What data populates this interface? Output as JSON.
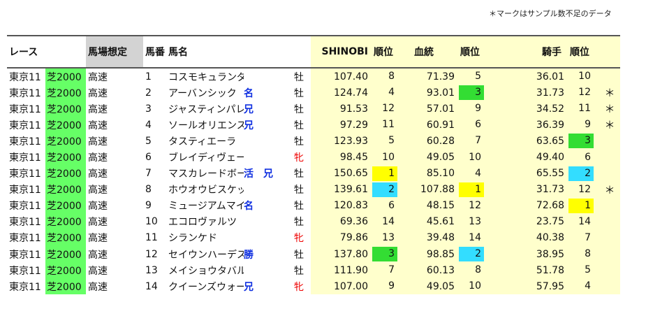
{
  "note": "＊マークはサンプル数不足のデータ",
  "headers": {
    "race": "レース",
    "condition": "馬場想定",
    "number": "馬番",
    "name": "馬名",
    "shinobi": "SHINOBI",
    "shinobi_rank": "順位",
    "blood": "血統",
    "blood_rank": "順位",
    "jockey": "騎手",
    "jockey_rank": "順位"
  },
  "colors": {
    "surface_green": "#66ff66",
    "highlight_yellow": "#ffff00",
    "highlight_green": "#33dd33",
    "highlight_cyan": "#33ddff",
    "pale_yellow": "#ffffcc",
    "mark_blue": "#1030e0",
    "female_red": "#ee0000"
  },
  "rows": [
    {
      "race": "東京11",
      "surface": "芝2000",
      "cond": "高速",
      "num": "1",
      "name": "コスモキュランダ",
      "mark": "",
      "sex": "牡",
      "shinobi": "107.40",
      "sr": "8",
      "srh": "",
      "blood": "71.39",
      "br": "5",
      "brh": "",
      "jockey": "36.01",
      "jr": "10",
      "jrh": "",
      "star": ""
    },
    {
      "race": "東京11",
      "surface": "芝2000",
      "cond": "高速",
      "num": "2",
      "name": "アーバンシック",
      "mark": "名",
      "sex": "牡",
      "shinobi": "124.74",
      "sr": "4",
      "srh": "",
      "blood": "93.01",
      "br": "3",
      "brh": "green",
      "jockey": "31.73",
      "jr": "12",
      "jrh": "",
      "star": "＊"
    },
    {
      "race": "東京11",
      "surface": "芝2000",
      "cond": "高速",
      "num": "3",
      "name": "ジャスティンパレス",
      "mark": "兄",
      "sex": "牡",
      "shinobi": "91.53",
      "sr": "12",
      "srh": "",
      "blood": "57.01",
      "br": "9",
      "brh": "",
      "jockey": "34.52",
      "jr": "11",
      "jrh": "",
      "star": "＊"
    },
    {
      "race": "東京11",
      "surface": "芝2000",
      "cond": "高速",
      "num": "4",
      "name": "ソールオリエンス",
      "mark": "兄",
      "sex": "牡",
      "shinobi": "97.29",
      "sr": "11",
      "srh": "",
      "blood": "60.91",
      "br": "6",
      "brh": "",
      "jockey": "36.39",
      "jr": "9",
      "jrh": "",
      "star": "＊"
    },
    {
      "race": "東京11",
      "surface": "芝2000",
      "cond": "高速",
      "num": "5",
      "name": "タスティエーラ",
      "mark": "",
      "sex": "牡",
      "shinobi": "123.93",
      "sr": "5",
      "srh": "",
      "blood": "60.28",
      "br": "7",
      "brh": "",
      "jockey": "63.65",
      "jr": "3",
      "jrh": "green",
      "star": ""
    },
    {
      "race": "東京11",
      "surface": "芝2000",
      "cond": "高速",
      "num": "6",
      "name": "ブレイディヴェーグ",
      "mark": "",
      "sex": "牝",
      "shinobi": "98.45",
      "sr": "10",
      "srh": "",
      "blood": "49.05",
      "br": "10",
      "brh": "",
      "jockey": "49.40",
      "jr": "6",
      "jrh": "",
      "star": ""
    },
    {
      "race": "東京11",
      "surface": "芝2000",
      "cond": "高速",
      "num": "7",
      "name": "マスカレードボール",
      "mark": "活　兄",
      "sex": "牡",
      "shinobi": "150.65",
      "sr": "1",
      "srh": "yellow",
      "blood": "85.10",
      "br": "4",
      "brh": "",
      "jockey": "65.55",
      "jr": "2",
      "jrh": "cyan",
      "star": ""
    },
    {
      "race": "東京11",
      "surface": "芝2000",
      "cond": "高速",
      "num": "8",
      "name": "ホウオウビスケッツ",
      "mark": "",
      "sex": "牡",
      "shinobi": "139.61",
      "sr": "2",
      "srh": "cyan",
      "blood": "107.88",
      "br": "1",
      "brh": "yellow",
      "jockey": "31.73",
      "jr": "12",
      "jrh": "",
      "star": "＊"
    },
    {
      "race": "東京11",
      "surface": "芝2000",
      "cond": "高速",
      "num": "9",
      "name": "ミュージアムマイル",
      "mark": "名",
      "sex": "牡",
      "shinobi": "120.83",
      "sr": "6",
      "srh": "",
      "blood": "48.15",
      "br": "12",
      "brh": "",
      "jockey": "72.68",
      "jr": "1",
      "jrh": "yellow",
      "star": ""
    },
    {
      "race": "東京11",
      "surface": "芝2000",
      "cond": "高速",
      "num": "10",
      "name": "エコロヴァルツ",
      "mark": "",
      "sex": "牡",
      "shinobi": "69.36",
      "sr": "14",
      "srh": "",
      "blood": "45.61",
      "br": "13",
      "brh": "",
      "jockey": "23.75",
      "jr": "14",
      "jrh": "",
      "star": ""
    },
    {
      "race": "東京11",
      "surface": "芝2000",
      "cond": "高速",
      "num": "11",
      "name": "シランケド",
      "mark": "",
      "sex": "牝",
      "shinobi": "79.86",
      "sr": "13",
      "srh": "",
      "blood": "39.48",
      "br": "14",
      "brh": "",
      "jockey": "40.38",
      "jr": "7",
      "jrh": "",
      "star": ""
    },
    {
      "race": "東京11",
      "surface": "芝2000",
      "cond": "高速",
      "num": "12",
      "name": "セイウンハーデス",
      "mark": "勝",
      "sex": "牡",
      "shinobi": "137.80",
      "sr": "3",
      "srh": "green",
      "blood": "98.85",
      "br": "2",
      "brh": "cyan",
      "jockey": "38.95",
      "jr": "8",
      "jrh": "",
      "star": ""
    },
    {
      "race": "東京11",
      "surface": "芝2000",
      "cond": "高速",
      "num": "13",
      "name": "メイショウタバル",
      "mark": "",
      "sex": "牡",
      "shinobi": "111.90",
      "sr": "7",
      "srh": "",
      "blood": "60.13",
      "br": "8",
      "brh": "",
      "jockey": "51.78",
      "jr": "5",
      "jrh": "",
      "star": ""
    },
    {
      "race": "東京11",
      "surface": "芝2000",
      "cond": "高速",
      "num": "14",
      "name": "クイーンズウォーク",
      "mark": "兄",
      "sex": "牝",
      "shinobi": "107.00",
      "sr": "9",
      "srh": "",
      "blood": "49.05",
      "br": "10",
      "brh": "",
      "jockey": "57.95",
      "jr": "4",
      "jrh": "",
      "star": ""
    }
  ]
}
